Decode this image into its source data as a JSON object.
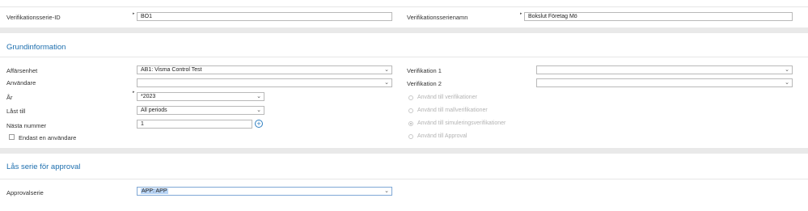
{
  "header": {
    "series_id_label": "Verifikationsserie-ID",
    "series_id_value": "BO1",
    "series_name_label": "Verifikationsserienamn",
    "series_name_value": "Bokslut Företag Mö"
  },
  "grundinformation": {
    "title": "Grundinformation",
    "business_unit_label": "Affärsenhet",
    "business_unit_value": "AB1: Visma Control Test",
    "user_label": "Användare",
    "user_value": "",
    "year_label": "År",
    "year_value": "*2023",
    "locked_label": "Låst till",
    "locked_value": "All periods",
    "next_number_label": "Nästa nummer",
    "next_number_value": "1",
    "single_user_label": "Endast en användare",
    "voucher1_label": "Verifikation 1",
    "voucher1_value": "",
    "voucher2_label": "Verifikation 2",
    "voucher2_value": "",
    "radio_options": [
      {
        "label": "Använd till verifikationer",
        "checked": false
      },
      {
        "label": "Använd till mallverifikationer",
        "checked": false
      },
      {
        "label": "Använd till simuleringsverifikationer",
        "checked": true
      },
      {
        "label": "Använd till Approval",
        "checked": false
      }
    ]
  },
  "approval": {
    "title": "Lås serie för approval",
    "series_label": "Approvalserie",
    "series_value": "APP: APP"
  },
  "icons": {
    "chevron": "chevron-down-icon",
    "plus": "plus-circle-icon",
    "required": "required-marker-icon"
  },
  "colors": {
    "accent": "#1c6eae",
    "selection": "#b8d4f5"
  }
}
